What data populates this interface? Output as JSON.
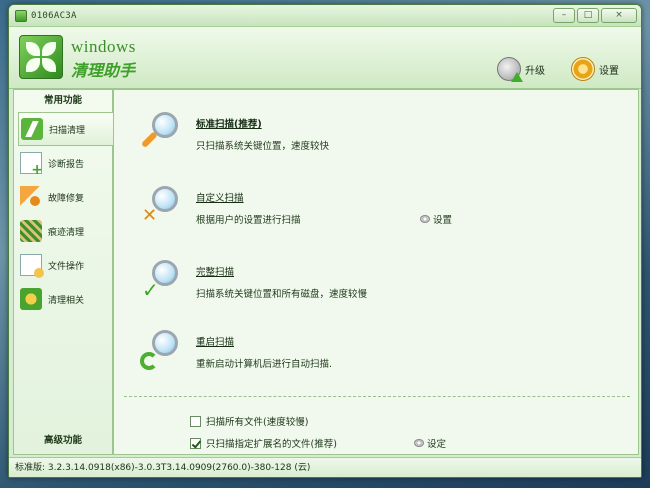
{
  "window": {
    "title": "0106AC3A",
    "controls": {
      "minimize": "–",
      "maximize": "□",
      "close": "×"
    }
  },
  "header": {
    "logo_main": "windows",
    "logo_sub": "清理助手",
    "upgrade_label": "升级",
    "settings_label": "设置"
  },
  "sidebar": {
    "section_top": "常用功能",
    "section_bottom": "高级功能",
    "items": [
      {
        "label": "扫描清理",
        "icon": "scan-clean-icon",
        "active": true
      },
      {
        "label": "诊断报告",
        "icon": "diagnose-report-icon"
      },
      {
        "label": "故障修复",
        "icon": "repair-icon"
      },
      {
        "label": "痕迹清理",
        "icon": "trace-clean-icon"
      },
      {
        "label": "文件操作",
        "icon": "file-operation-icon"
      },
      {
        "label": "清理相关",
        "icon": "clean-related-icon"
      }
    ]
  },
  "main": {
    "options": [
      {
        "title": "标准扫描(推荐)",
        "desc": "只扫描系统关键位置，速度较快"
      },
      {
        "title": "自定义扫描",
        "desc": "根据用户的设置进行扫描",
        "settings_label": "设置"
      },
      {
        "title": "完整扫描",
        "desc": "扫描系统关键位置和所有磁盘，速度较慢"
      },
      {
        "title": "重启扫描",
        "desc": "重新启动计算机后进行自动扫描."
      }
    ],
    "checkboxes": [
      {
        "label": "扫描所有文件(速度较慢)",
        "checked": false
      },
      {
        "label": "只扫描指定扩展名的文件(推荐)",
        "checked": true,
        "settings_label": "设定"
      }
    ]
  },
  "status": {
    "text": "标准版: 3.2.3.14.0918(x86)-3.0.3T3.14.0909(2760.0)-380-128 (云)"
  }
}
